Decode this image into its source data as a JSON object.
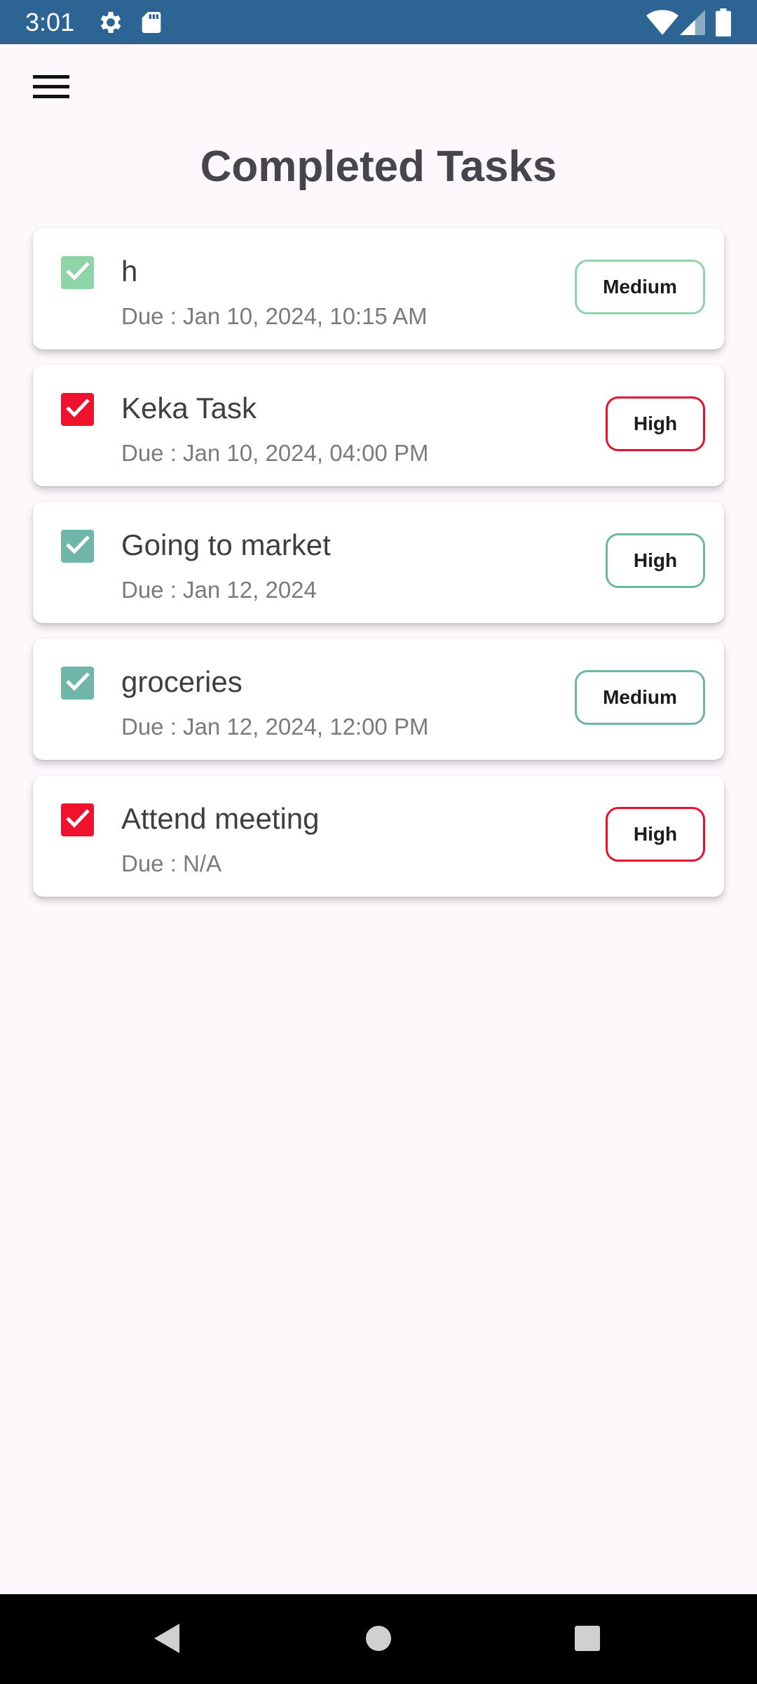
{
  "status_bar": {
    "time": "3:01",
    "left_icons": [
      "gear-icon",
      "sd-card-icon"
    ],
    "right_icons": [
      "wifi-icon",
      "cell-signal-icon",
      "battery-icon"
    ],
    "background": "#2c6494"
  },
  "header": {
    "menu_icon": "hamburger-menu-icon",
    "title": "Completed Tasks"
  },
  "tasks": [
    {
      "title": "h",
      "due": "Due : Jan 10, 2024, 10:15 AM",
      "priority": "Medium",
      "checked": true,
      "checkbox_color": "#8fd4a8",
      "chip_border_color": "#8fd4a8"
    },
    {
      "title": "Keka Task",
      "due": "Due : Jan 10, 2024, 04:00 PM",
      "priority": "High",
      "checked": true,
      "checkbox_color": "#f0112e",
      "chip_border_color": "#e8112d"
    },
    {
      "title": "Going to market",
      "due": "Due : Jan 12, 2024",
      "priority": "High",
      "checked": true,
      "checkbox_color": "#6fb5aa",
      "chip_border_color": "#6fb5aa"
    },
    {
      "title": "groceries",
      "due": "Due : Jan 12, 2024, 12:00 PM",
      "priority": "Medium",
      "checked": true,
      "checkbox_color": "#6fb5aa",
      "chip_border_color": "#6fb5aa"
    },
    {
      "title": "Attend meeting",
      "due": "Due : N/A",
      "priority": "High",
      "checked": true,
      "checkbox_color": "#f0112e",
      "chip_border_color": "#e8112d"
    }
  ],
  "nav_bar": {
    "buttons": [
      "back-icon",
      "home-icon",
      "recents-icon"
    ]
  },
  "colors": {
    "background": "#fdf8fc",
    "title_text": "#46444c",
    "due_text": "#7c7a80"
  }
}
